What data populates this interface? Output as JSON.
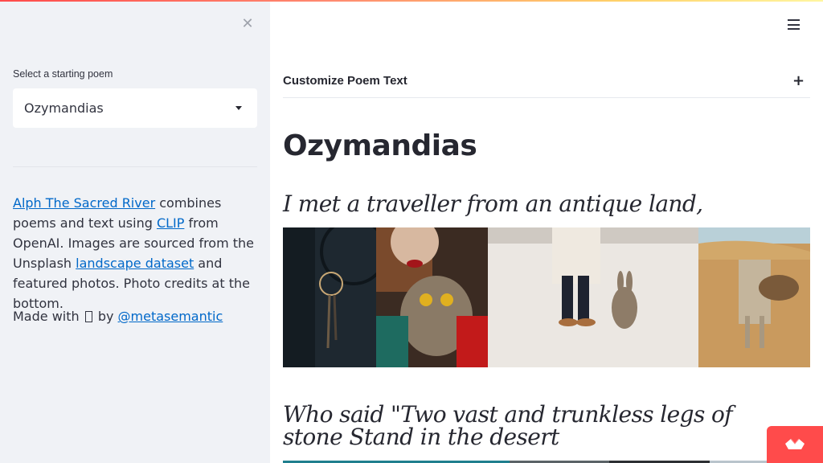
{
  "sidebar": {
    "close_icon": "close-icon",
    "select_label": "Select a starting poem",
    "select_value": "Ozymandias",
    "about": {
      "app_link": "Alph The Sacred River",
      "text1": " combines poems and text using ",
      "clip_link": "CLIP",
      "text2": " from OpenAI. Images are sourced from the Unsplash ",
      "dataset_link": "landscape dataset",
      "text3": " and featured photos. Photo credits at the bottom."
    },
    "made_with": {
      "prefix": "Made with ",
      "suffix": " by ",
      "author_link": "@metasemantic"
    }
  },
  "main": {
    "menu_icon": "hamburger-menu-icon",
    "expander_label": "Customize Poem Text",
    "title": "Ozymandias",
    "lines": [
      "I met a traveller from an antique land,",
      "Who said \"Two vast and trunkless legs of stone Stand in the desert"
    ],
    "images_row1": [
      {
        "name": "dreamcatcher-photo",
        "color": "#1f2a33"
      },
      {
        "name": "woman-with-owl-photo",
        "color": "#4a3528"
      },
      {
        "name": "rabbit-in-snow-photo",
        "color": "#e8e4df"
      },
      {
        "name": "desert-camels-photo",
        "color": "#c99a5e"
      }
    ],
    "images_row2": [
      {
        "name": "teal-photo",
        "color": "#1f7f8e"
      },
      {
        "name": "grey-photo",
        "color": "#5b6367"
      },
      {
        "name": "dark-photo",
        "color": "#2c2f33"
      },
      {
        "name": "light-photo",
        "color": "#b9c4cc"
      }
    ]
  },
  "colors": {
    "accent": "#ff4b4b",
    "link": "#0068c9",
    "sidebar_bg": "#f0f2f6"
  }
}
